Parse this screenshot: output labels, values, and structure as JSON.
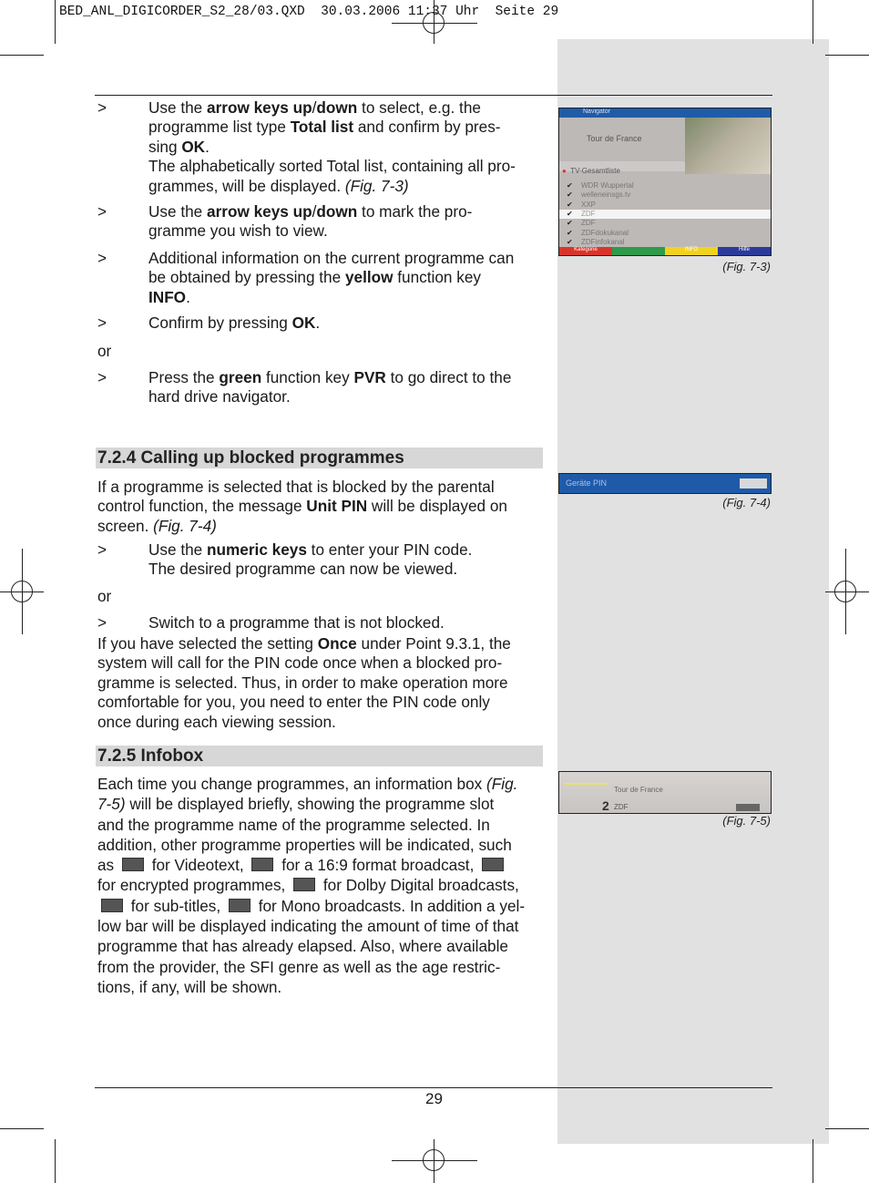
{
  "header": {
    "slug": "BED_ANL_DIGICORDER_S2_28/03.QXD  30.03.2006 11:37 Uhr  Seite 29"
  },
  "bullet": ">",
  "items_top": [
    {
      "lines": [
        [
          [
            "Use the "
          ],
          [
            "arrow keys up",
            "b"
          ],
          [
            "/"
          ],
          [
            "down",
            "b"
          ],
          [
            " to select, e.g. the"
          ]
        ],
        [
          [
            "programme list type "
          ],
          [
            "Total list",
            "b"
          ],
          [
            " and confirm by pres-"
          ]
        ],
        [
          [
            "sing "
          ],
          [
            "OK",
            "b"
          ],
          [
            "."
          ]
        ],
        [
          [
            "The alphabetically sorted Total list, containing all pro-"
          ]
        ],
        [
          [
            "grammes, will be displayed. "
          ],
          [
            "(Fig. 7-3)",
            "i"
          ]
        ]
      ]
    },
    {
      "lines": [
        [
          [
            "Use the "
          ],
          [
            "arrow keys up",
            "b"
          ],
          [
            "/"
          ],
          [
            "down",
            "b"
          ],
          [
            " to mark the pro-"
          ]
        ],
        [
          [
            "gramme you wish to view."
          ]
        ]
      ]
    },
    {
      "lines": [
        [
          [
            "Additional information on the current programme can"
          ]
        ],
        [
          [
            "be obtained by pressing the "
          ],
          [
            "yellow",
            "b"
          ],
          [
            " function key"
          ]
        ],
        [
          [
            "INFO",
            "b"
          ],
          [
            "."
          ]
        ]
      ]
    },
    {
      "lines": [
        [
          [
            "Confirm by pressing "
          ],
          [
            "OK",
            "b"
          ],
          [
            "."
          ]
        ]
      ]
    },
    {
      "lines": [
        [
          [
            "Press the "
          ],
          [
            "green",
            "b"
          ],
          [
            " function key "
          ],
          [
            "PVR",
            "b"
          ],
          [
            " to go direct to the"
          ]
        ],
        [
          [
            "hard drive navigator."
          ]
        ]
      ]
    }
  ],
  "or_label": "or",
  "section_724": {
    "heading": "7.2.4 Calling up blocked programmes",
    "intro": [
      [
        [
          "If a programme is selected that is blocked by the parental"
        ]
      ],
      [
        [
          "control function, the message "
        ],
        [
          "Unit PIN",
          "b"
        ],
        [
          " will be displayed on"
        ]
      ],
      [
        [
          "screen. "
        ],
        [
          "(Fig. 7-4)",
          "i"
        ]
      ]
    ],
    "step1": [
      [
        [
          "Use the "
        ],
        [
          "numeric keys",
          "b"
        ],
        [
          " to enter your PIN code."
        ]
      ],
      [
        [
          "The desired programme can now be viewed."
        ]
      ]
    ],
    "step2": [
      [
        [
          "Switch to a programme that is not blocked."
        ]
      ]
    ],
    "outro": [
      [
        [
          "If you have selected the setting "
        ],
        [
          "Once",
          "b"
        ],
        [
          " under Point 9.3.1, the"
        ]
      ],
      [
        [
          "system will call for the PIN code once when a blocked pro-"
        ]
      ],
      [
        [
          "gramme is selected. Thus, in order to make operation more"
        ]
      ],
      [
        [
          "comfortable for you, you need to enter the PIN code only"
        ]
      ],
      [
        [
          "once during each viewing session."
        ]
      ]
    ]
  },
  "section_725": {
    "heading": "7.2.5 Infobox",
    "body": [
      [
        [
          "Each time you change programmes, an information box "
        ],
        [
          "(Fig.",
          "i"
        ]
      ],
      [
        [
          "7-5)",
          "i"
        ],
        [
          " will be displayed briefly, showing the programme slot"
        ]
      ],
      [
        [
          "and the programme name of the programme selected. In"
        ]
      ],
      [
        [
          "addition, other programme properties will be indicated, such"
        ]
      ],
      [
        [
          "as "
        ],
        [
          "txt-icon",
          "icon"
        ],
        [
          " for Videotext, "
        ],
        [
          "16-9-icon",
          "icon"
        ],
        [
          " for a 16:9 format broadcast, "
        ],
        [
          "key-icon",
          "icon"
        ]
      ],
      [
        [
          "for encrypted programmes, "
        ],
        [
          "dolby-icon",
          "icon"
        ],
        [
          " for Dolby Digital broadcasts,"
        ]
      ],
      [
        [
          "subtitle-icon",
          "icon"
        ],
        [
          " for sub-titles, "
        ],
        [
          "mono-icon",
          "icon"
        ],
        [
          " for Mono broadcasts. In addition a yel-"
        ]
      ],
      [
        [
          "low bar will be displayed indicating the amount of time of that"
        ]
      ],
      [
        [
          "programme that has already elapsed. Also, where available"
        ]
      ],
      [
        [
          "from the provider, the SFI genre as well as the age restric-"
        ]
      ],
      [
        [
          "tions, if any, will be shown."
        ]
      ]
    ]
  },
  "figures": {
    "fig73": {
      "caption": "(Fig. 7-3)",
      "title": "Navigator",
      "programme": "Tour de France",
      "list": "TV-Gesamtliste",
      "channels": [
        "WDR Wuppertal",
        "welleneinsgs.tv",
        "XXP",
        "ZDF",
        "ZDF",
        "ZDFdokukanal",
        "ZDFinfokanal"
      ],
      "selected_index": 3,
      "keys": [
        "Kategorie",
        "",
        "INFO",
        "Hilfe"
      ],
      "key_colors": [
        "#d8352a",
        "#2e9a4a",
        "#f2d21e",
        "#2c3a9a"
      ]
    },
    "fig74": {
      "caption": "(Fig. 7-4)",
      "label": "Geräte PIN"
    },
    "fig75": {
      "caption": "(Fig. 7-5)",
      "slot": "2",
      "channel": "ZDF",
      "programme": "Tour de France"
    }
  },
  "page_number": "29"
}
